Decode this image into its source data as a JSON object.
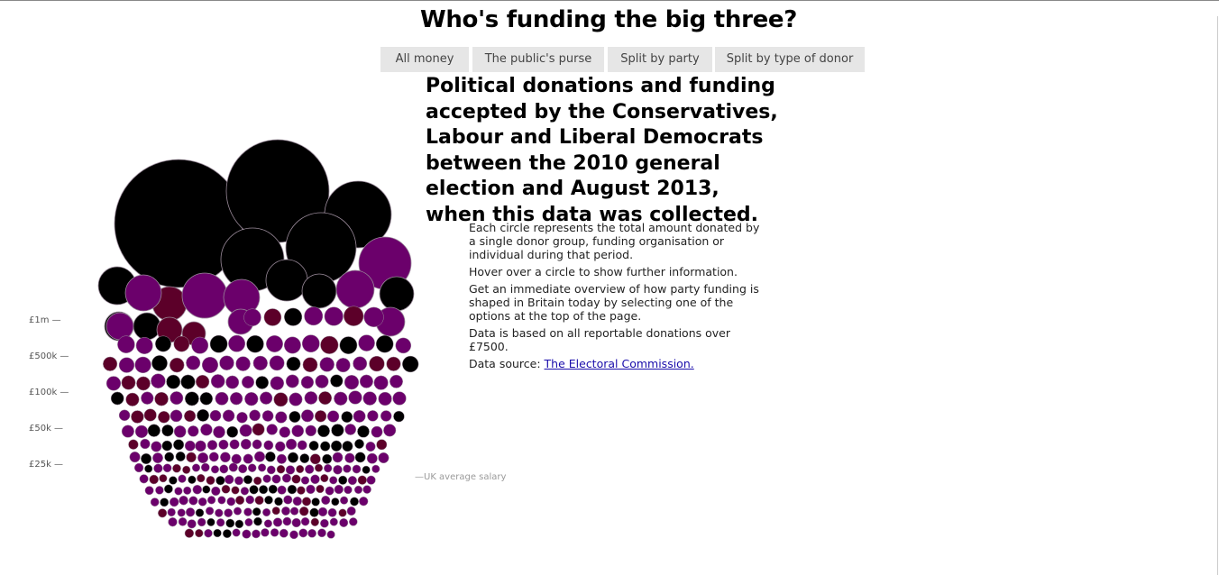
{
  "page": {
    "title": "Who's funding the big three?",
    "nav": [
      {
        "label": "All money"
      },
      {
        "label": "The public's purse"
      },
      {
        "label": "Split by party"
      },
      {
        "label": "Split by type of donor"
      }
    ],
    "headline": "Political donations and funding accepted by the Conservatives, Labour and Liberal Democrats between the 2010 general election and August 2013, when this data was collected.",
    "notes": {
      "p1": "Each circle represents the total amount donated by a single donor group, funding organisation or individual during that period.",
      "p2": "Hover over a circle to show further information.",
      "p3": "Get an immediate overview of how party funding is shaped in Britain today by selecting one of the options at the top of the page.",
      "p4": "Data is based on all reportable donations over £7500.",
      "source_prefix": "Data source:",
      "source_link": "The Electoral Commission."
    }
  },
  "chart_data": {
    "type": "scatter",
    "scale_labels": [
      "£1m —",
      "£500k —",
      "£100k —",
      "£50k —",
      "£25k —"
    ],
    "reference_label": "—UK average salary",
    "colors": {
      "black": "#000000",
      "purple": "#6b006b",
      "maroon": "#5c0029",
      "stroke": "#9a8a9a"
    },
    "large_bubbles": [
      {
        "color": "black"
      },
      {
        "color": "black"
      },
      {
        "color": "black"
      },
      {
        "color": "black"
      },
      {
        "color": "black"
      },
      {
        "color": "black"
      },
      {
        "color": "black"
      },
      {
        "color": "purple"
      },
      {
        "color": "black"
      },
      {
        "color": "purple"
      },
      {
        "color": "maroon"
      },
      {
        "color": "purple"
      },
      {
        "color": "purple"
      },
      {
        "color": "purple"
      },
      {
        "color": "black"
      },
      {
        "color": "black"
      },
      {
        "color": "purple"
      },
      {
        "color": "black"
      },
      {
        "color": "maroon"
      },
      {
        "color": "maroon"
      },
      {
        "color": "purple"
      },
      {
        "color": "purple"
      }
    ]
  }
}
